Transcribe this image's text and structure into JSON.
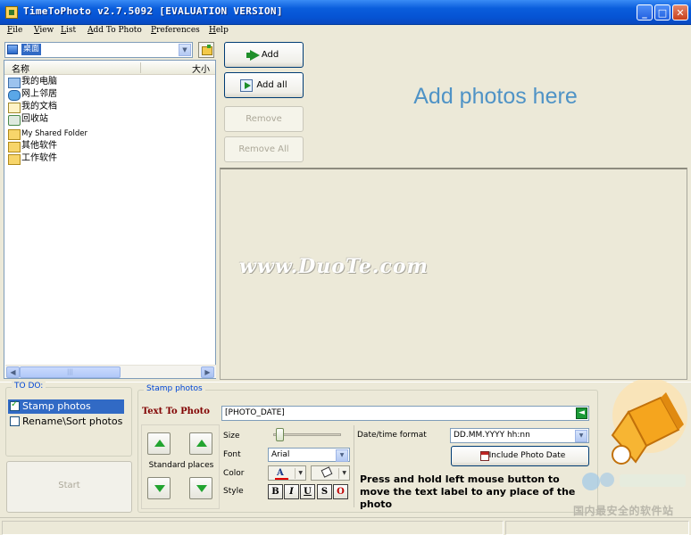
{
  "window": {
    "title": "TimeToPhoto v2.7.5092 [EVALUATION VERSION]"
  },
  "menu": {
    "items": [
      "File",
      "View",
      "List",
      "Add To Photo",
      "Preferences",
      "Help"
    ]
  },
  "browser": {
    "drive_selected": "桌面",
    "columns": {
      "name": "名称",
      "size": "大小"
    },
    "items": [
      {
        "label": "我的电脑",
        "icon": "computer-icon"
      },
      {
        "label": "网上邻居",
        "icon": "network-icon"
      },
      {
        "label": "我的文档",
        "icon": "documents-icon"
      },
      {
        "label": "回收站",
        "icon": "recycle-bin-icon"
      },
      {
        "label": "My Shared Folder",
        "icon": "folder-icon"
      },
      {
        "label": "其他软件",
        "icon": "folder-icon"
      },
      {
        "label": "工作软件",
        "icon": "folder-icon"
      }
    ]
  },
  "photo_buttons": {
    "add": "Add",
    "add_all": "Add all",
    "remove": "Remove",
    "remove_all": "Remove All"
  },
  "photo_area": {
    "hint": "Add photos here",
    "watermark": "www.DuoTe.com"
  },
  "todo": {
    "title": "TO DO:",
    "items": [
      {
        "label": "Stamp photos",
        "checked": true,
        "selected": true
      },
      {
        "label": "Rename\\Sort photos",
        "checked": false,
        "selected": false
      }
    ],
    "start_label": "Start"
  },
  "stamp": {
    "title": "Stamp photos",
    "text_to_photo_label": "Text To Photo",
    "text_value": "[PHOTO_DATE]",
    "standard_places_label": "Standard places",
    "size_label": "Size",
    "font_label": "Font",
    "font_value": "Arial",
    "color_label": "Color",
    "style_label": "Style",
    "style_buttons": [
      "B",
      "I",
      "U",
      "S",
      "O"
    ],
    "date_format_label": "Date/time format",
    "date_format_value": "DD.MM.YYYY hh:nn",
    "include_date_button": "Include Photo Date",
    "hint": "Press and hold left mouse button to move the text label to any place of the photo"
  },
  "corner": {
    "site_text": "国内最安全的软件站"
  },
  "colors": {
    "accent_blue": "#4f93c6",
    "title_bar": "#0654d4",
    "text_to_photo": "#800000"
  }
}
